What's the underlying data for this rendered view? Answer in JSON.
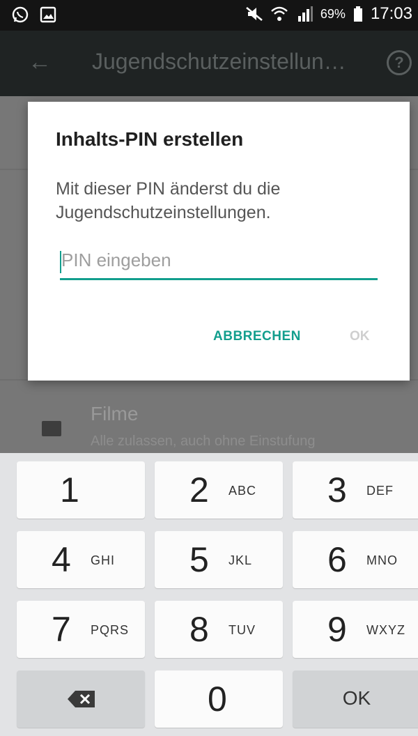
{
  "status_bar": {
    "battery_percent": "69%",
    "time": "17:03"
  },
  "app_bar": {
    "title": "Jugendschutzeinstellun…",
    "help_glyph": "?"
  },
  "background_list": {
    "item_title": "Filme",
    "item_subtitle": "Alle zulassen, auch ohne Einstufung"
  },
  "dialog": {
    "title": "Inhalts-PIN erstellen",
    "message": "Mit dieser PIN änderst du die Jugendschutzeinstellungen.",
    "input_placeholder": "PIN eingeben",
    "cancel_label": "ABBRECHEN",
    "ok_label": "OK"
  },
  "keypad": {
    "keys": [
      {
        "digit": "1",
        "letters": ""
      },
      {
        "digit": "2",
        "letters": "ABC"
      },
      {
        "digit": "3",
        "letters": "DEF"
      },
      {
        "digit": "4",
        "letters": "GHI"
      },
      {
        "digit": "5",
        "letters": "JKL"
      },
      {
        "digit": "6",
        "letters": "MNO"
      },
      {
        "digit": "7",
        "letters": "PQRS"
      },
      {
        "digit": "8",
        "letters": "TUV"
      },
      {
        "digit": "9",
        "letters": "WXYZ"
      },
      {
        "digit": "0",
        "letters": ""
      }
    ],
    "ok_label": "OK"
  },
  "colors": {
    "accent": "#129e8d",
    "disabled": "#cfcfcf"
  }
}
